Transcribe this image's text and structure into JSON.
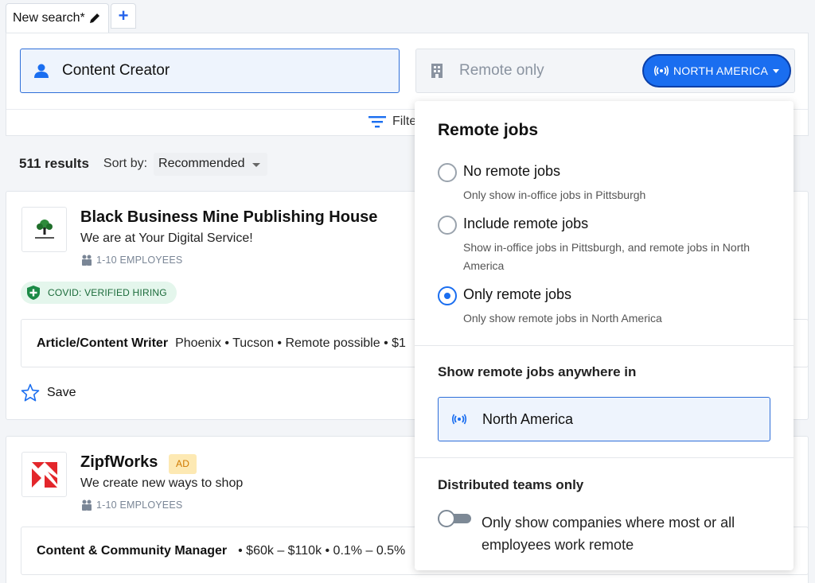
{
  "tabs": {
    "active_label": "New search*",
    "add_label": "+"
  },
  "search": {
    "role_value": "Content Creator",
    "location_value": "Remote only",
    "region_button": "NORTH AMERICA",
    "filters_label": "Filte"
  },
  "results": {
    "count": "511 results",
    "sort_label": "Sort by:",
    "sort_value": "Recommended"
  },
  "cards": [
    {
      "company": "Black Business Mine Publishing House",
      "tagline": "We are at Your Digital Service!",
      "employees": "1-10 EMPLOYEES",
      "badge": "COVID: VERIFIED HIRING",
      "job_title": "Article/Content Writer",
      "job_meta": "Phoenix • Tucson • Remote possible • $1",
      "save_label": "Save"
    },
    {
      "company": "ZipfWorks",
      "ad_label": "AD",
      "tagline": "We create new ways to shop",
      "employees": "1-10 EMPLOYEES",
      "job_title": "Content & Community Manager",
      "job_meta": "• $60k – $110k • 0.1% – 0.5%"
    }
  ],
  "dropdown": {
    "title": "Remote jobs",
    "options": [
      {
        "label": "No remote jobs",
        "desc": "Only show in-office jobs in Pittsburgh",
        "selected": false
      },
      {
        "label": "Include remote jobs",
        "desc": "Show in-office jobs in Pittsburgh, and remote jobs in North America",
        "selected": false
      },
      {
        "label": "Only remote jobs",
        "desc": "Only show remote jobs in North America",
        "selected": true
      }
    ],
    "anywhere_title": "Show remote jobs anywhere in",
    "region_value": "North America",
    "distributed_title": "Distributed teams only",
    "toggle_text": "Only show companies where most or all employees work remote",
    "toggle_on": false
  },
  "colors": {
    "accent": "#1a6ef0",
    "badge_green": "#e4f6ec",
    "ad_yellow": "#fde9b3"
  }
}
